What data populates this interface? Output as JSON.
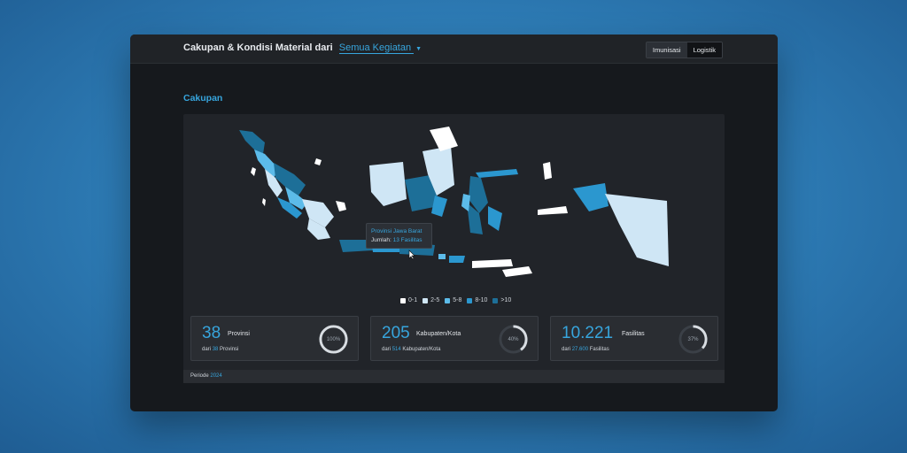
{
  "header": {
    "title": "Cakupan & Kondisi Material dari",
    "filter_label": "Semua Kegiatan",
    "tabs": [
      {
        "label": "Imunisasi",
        "active": true
      },
      {
        "label": "Logistik",
        "active": false
      }
    ]
  },
  "section": {
    "title": "Cakupan"
  },
  "map": {
    "tooltip": {
      "province": "Provinsi Jawa Barat",
      "count_label": "Jumlah:",
      "count_value": "13 Fasilitas"
    },
    "legend": [
      {
        "label": "0-1",
        "color": "#ffffff"
      },
      {
        "label": "2-5",
        "color": "#cfe6f5"
      },
      {
        "label": "5-8",
        "color": "#5cbbe9"
      },
      {
        "label": "8-10",
        "color": "#2b97cf"
      },
      {
        "label": ">10",
        "color": "#1d6f98"
      }
    ]
  },
  "cards": [
    {
      "value": "38",
      "unit": "Provinsi",
      "sub_prefix": "dari",
      "sub_total": "38",
      "sub_unit": "Provinsi",
      "percent_label": "100%",
      "percent": 1.0
    },
    {
      "value": "205",
      "unit": "Kabupaten/Kota",
      "sub_prefix": "dari",
      "sub_total": "514",
      "sub_unit": "Kabupaten/Kota",
      "percent_label": "40%",
      "percent": 0.4
    },
    {
      "value": "10.221",
      "unit": "Fasilitas",
      "sub_prefix": "dari",
      "sub_total": "27.600",
      "sub_unit": "Fasilitas",
      "percent_label": "37%",
      "percent": 0.37
    }
  ],
  "footer": {
    "label": "Periode",
    "year": "2024"
  },
  "colors": {
    "accent": "#37a5dd",
    "ring_track": "#3b4047",
    "ring_fill": "#d8dde2"
  }
}
